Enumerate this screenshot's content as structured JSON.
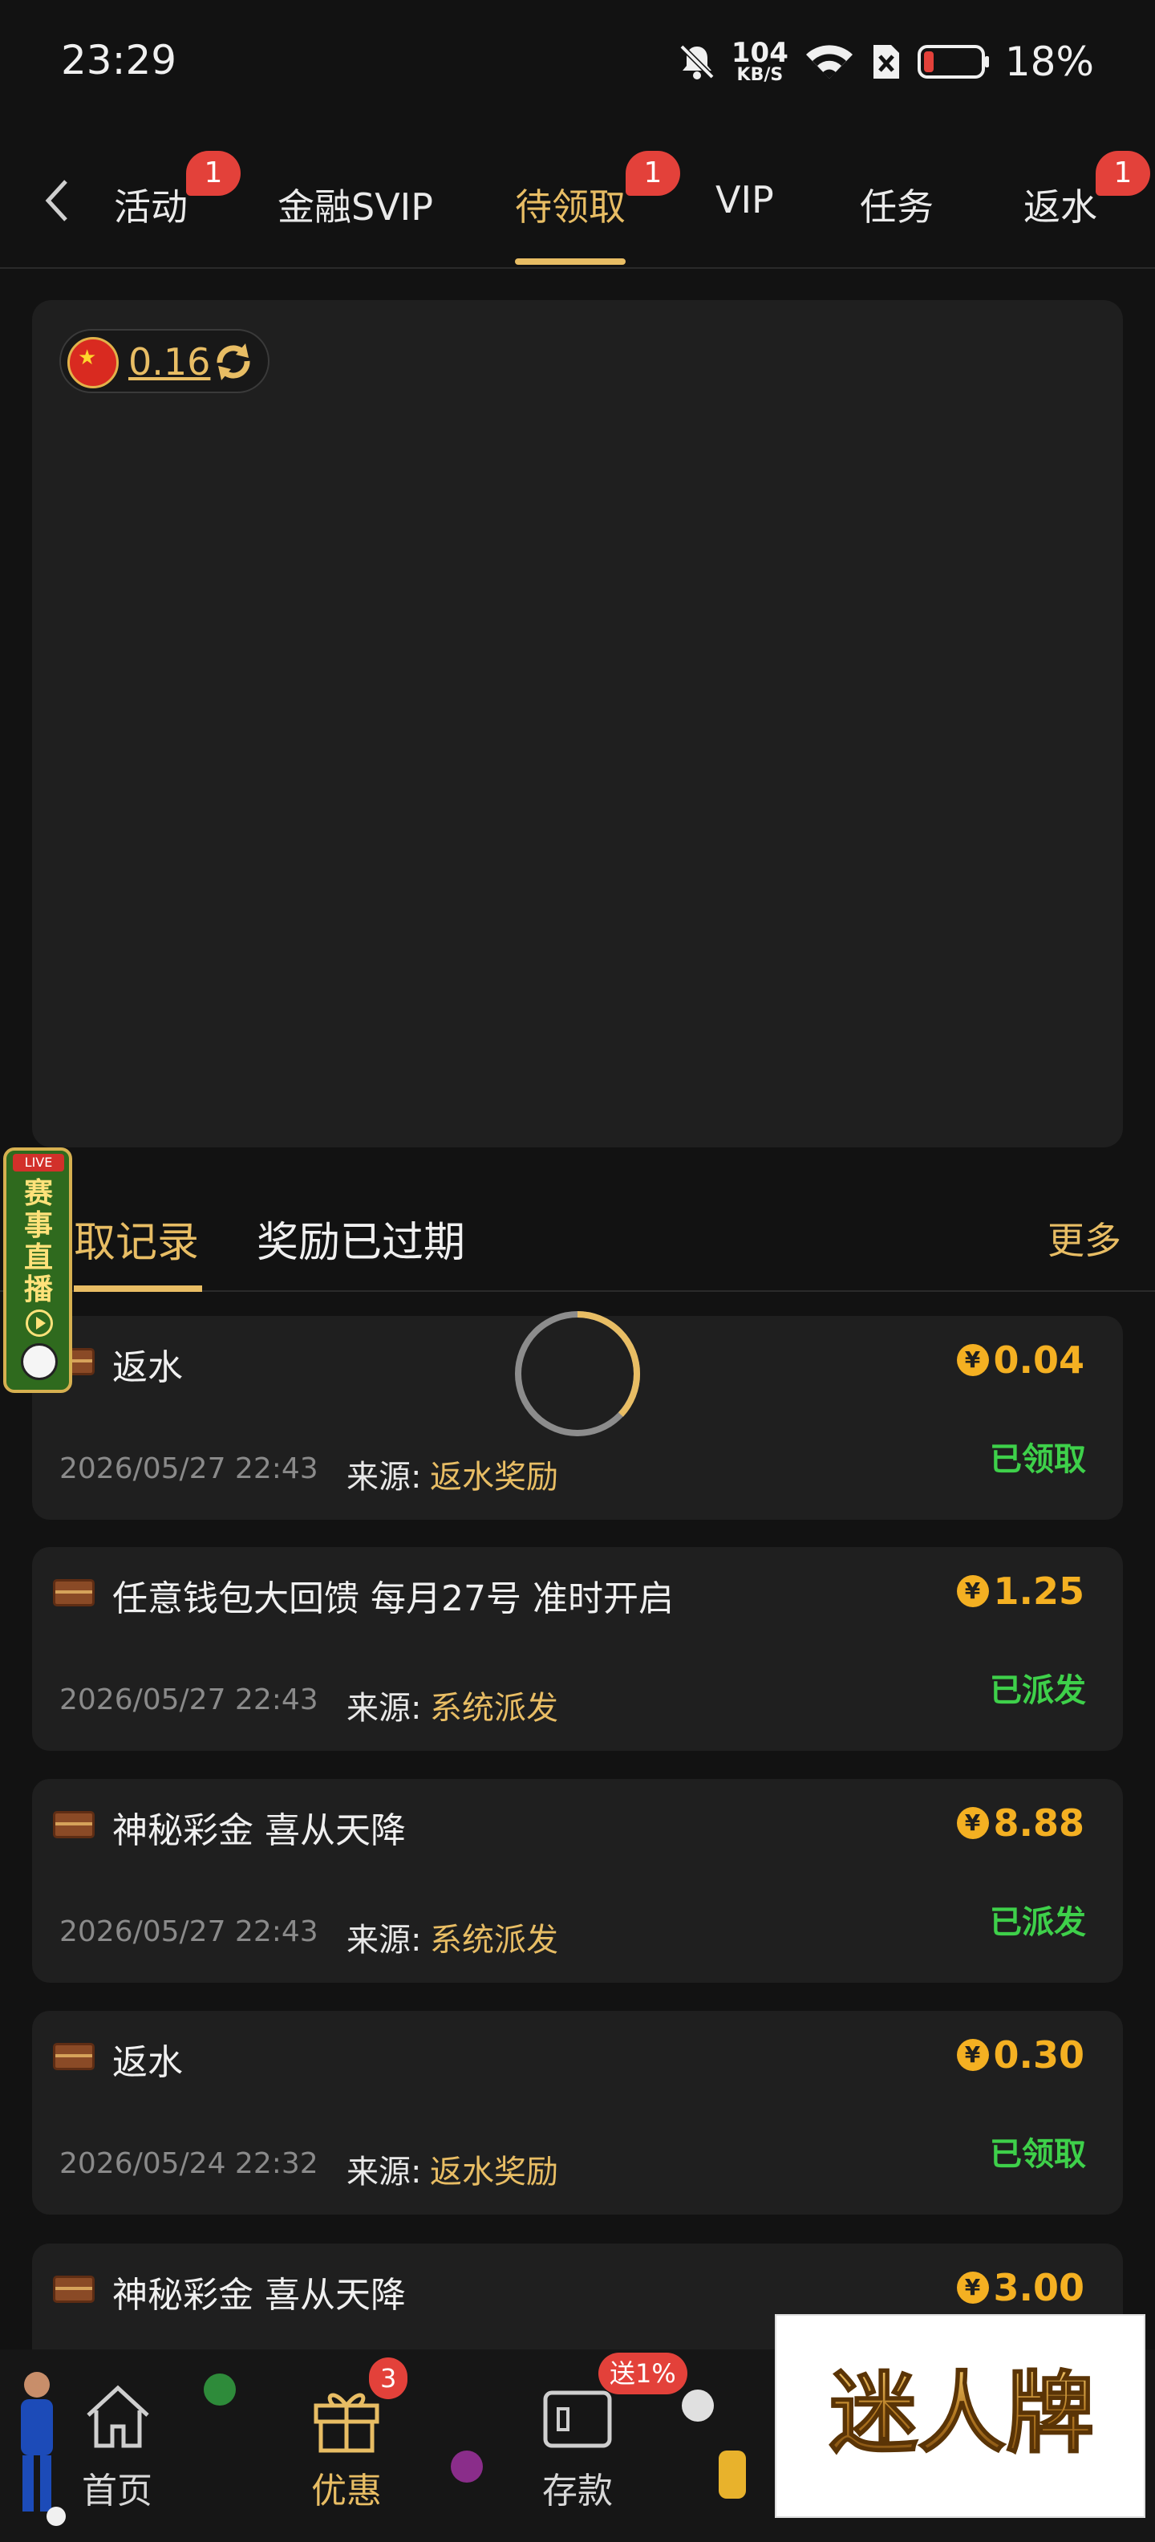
{
  "status_bar": {
    "time": "23:29",
    "net_speed_value": "104",
    "net_speed_unit": "KB/S",
    "battery_percent": "18%"
  },
  "top_tabs": {
    "items": [
      {
        "label": "活动",
        "badge": "1"
      },
      {
        "label": "金融SVIP"
      },
      {
        "label": "待领取",
        "badge": "1",
        "active": true
      },
      {
        "label": "VIP"
      },
      {
        "label": "任务"
      },
      {
        "label": "返水",
        "badge": "1"
      }
    ]
  },
  "balance": {
    "value": "0.16"
  },
  "records_section": {
    "tab_claimed": "取记录",
    "tab_expired": "奖励已过期",
    "more": "更多",
    "source_label": "来源:",
    "items": [
      {
        "title": "返水",
        "amount": "0.04",
        "status": "已领取",
        "date": "2026/05/27 22:43",
        "source": "返水奖励"
      },
      {
        "title": "任意钱包大回馈 每月27号 准时开启",
        "amount": "1.25",
        "status": "已派发",
        "date": "2026/05/27 22:43",
        "source": "系统派发"
      },
      {
        "title": "神秘彩金 喜从天降",
        "amount": "8.88",
        "status": "已派发",
        "date": "2026/05/27 22:43",
        "source": "系统派发"
      },
      {
        "title": "返水",
        "amount": "0.30",
        "status": "已领取",
        "date": "2026/05/24 22:32",
        "source": "返水奖励"
      },
      {
        "title": "神秘彩金 喜从天降",
        "amount": "3.00"
      }
    ]
  },
  "live_widget": {
    "tag": "LIVE",
    "text": "赛事直播"
  },
  "bottom_nav": {
    "home": "首页",
    "offers": "优惠",
    "offers_badge": "3",
    "deposit": "存款",
    "deposit_badge": "送1%"
  },
  "brand": {
    "logo_text": "迷人牌"
  },
  "colors": {
    "accent_gold": "#e8bd64",
    "amount_orange": "#f4b022",
    "status_green": "#3ed04a",
    "badge_red": "#e3413a",
    "background": "#121212",
    "card": "#1f1f1f"
  }
}
